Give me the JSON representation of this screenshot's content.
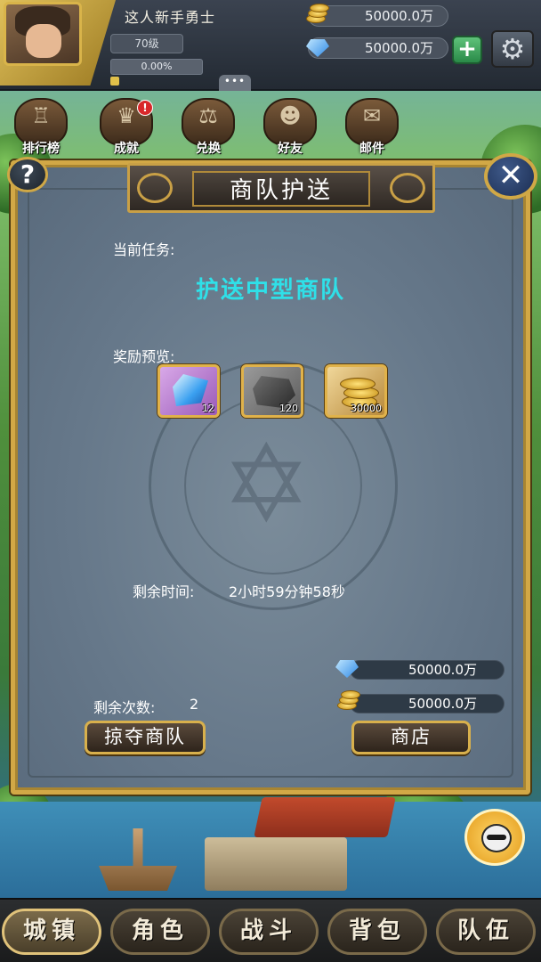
{
  "topbar": {
    "player_name": "这人新手勇士",
    "level": "70级",
    "exp_percent": "0.00%",
    "exp_fraction": 0.0,
    "gold_amount": "50000.0万",
    "gem_amount": "50000.0万",
    "chat_tab": "•••"
  },
  "features": [
    {
      "label": "排行榜",
      "icon": "ranking-icon"
    },
    {
      "label": "成就",
      "icon": "achievement-icon",
      "badge": "!"
    },
    {
      "label": "兑换",
      "icon": "exchange-icon"
    },
    {
      "label": "好友",
      "icon": "friends-icon"
    },
    {
      "label": "邮件",
      "icon": "mail-icon"
    }
  ],
  "modal": {
    "title": "商队护送",
    "help": "?",
    "close": "✕",
    "task_label": "当前任务:",
    "task_name": "护送中型商队",
    "reward_label": "奖励预览:",
    "rewards": [
      {
        "type": "gem",
        "count": "12"
      },
      {
        "type": "ore",
        "count": "120"
      },
      {
        "type": "gold",
        "count": "30000"
      }
    ],
    "remain_time_label": "剩余时间:",
    "remain_time_value": "2小时59分钟58秒",
    "gem_balance": "50000.0万",
    "gold_balance": "50000.0万",
    "remain_count_label": "剩余次数:",
    "remain_count_value": "2",
    "plunder_button": "掠夺商队",
    "shop_button": "商店"
  },
  "bottom_nav": [
    {
      "label": "城镇",
      "active": true
    },
    {
      "label": "角色"
    },
    {
      "label": "战斗"
    },
    {
      "label": "背包"
    },
    {
      "label": "队伍"
    }
  ],
  "colors": {
    "frame_gold": "#d2a846",
    "task_cyan": "#2fe0e8",
    "modal_bg": "#66788a"
  }
}
